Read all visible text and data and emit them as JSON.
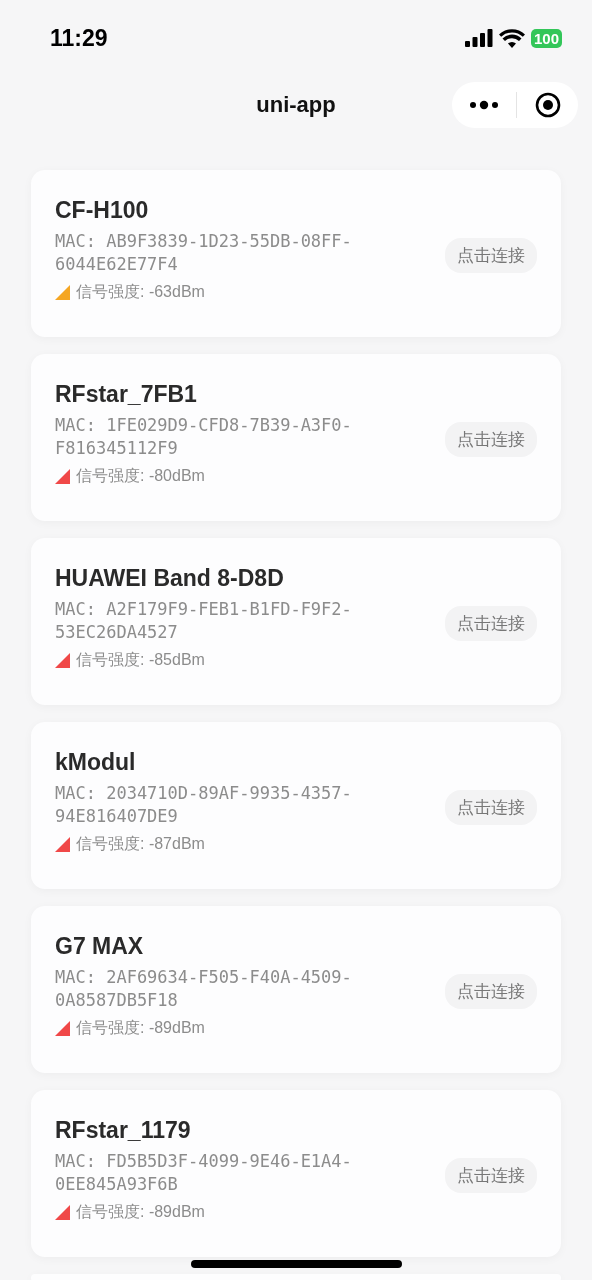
{
  "status_bar": {
    "time": "11:29",
    "battery": "100"
  },
  "nav": {
    "title": "uni-app"
  },
  "devices": [
    {
      "name": "CF-H100",
      "mac": "MAC: AB9F3839-1D23-55DB-08FF-6044E62E77F4",
      "signal_label": "信号强度: ",
      "rssi": "-63dBm",
      "color": "#f5a623",
      "action": "点击连接"
    },
    {
      "name": "RFstar_7FB1",
      "mac": "MAC: 1FE029D9-CFD8-7B39-A3F0-F816345112F9",
      "signal_label": "信号强度: ",
      "rssi": "-80dBm",
      "color": "#f04848",
      "action": "点击连接"
    },
    {
      "name": "HUAWEI Band 8-D8D",
      "mac": "MAC: A2F179F9-FEB1-B1FD-F9F2-53EC26DA4527",
      "signal_label": "信号强度: ",
      "rssi": "-85dBm",
      "color": "#f04848",
      "action": "点击连接"
    },
    {
      "name": "kModul",
      "mac": "MAC: 2034710D-89AF-9935-4357-94E816407DE9",
      "signal_label": "信号强度: ",
      "rssi": "-87dBm",
      "color": "#f04848",
      "action": "点击连接"
    },
    {
      "name": "G7 MAX",
      "mac": "MAC: 2AF69634-F505-F40A-4509-0A8587DB5F18",
      "signal_label": "信号强度: ",
      "rssi": "-89dBm",
      "color": "#f04848",
      "action": "点击连接"
    },
    {
      "name": "RFstar_1179",
      "mac": "MAC: FD5B5D3F-4099-9E46-E1A4-0EE845A93F6B",
      "signal_label": "信号强度: ",
      "rssi": "-89dBm",
      "color": "#f04848",
      "action": "点击连接"
    }
  ]
}
